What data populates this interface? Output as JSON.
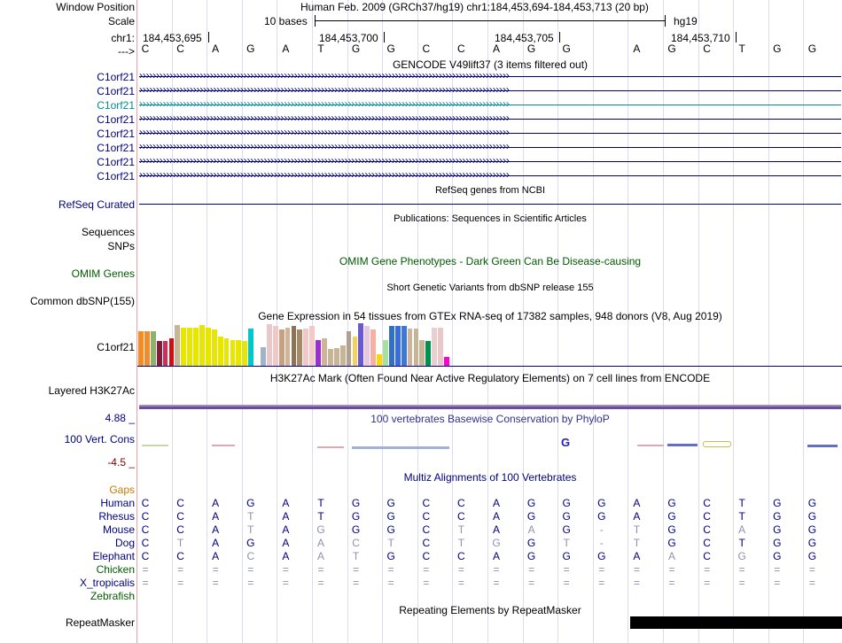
{
  "window_position": {
    "label": "Window Position",
    "text": "Human Feb. 2009 (GRCh37/hg19)   chr1:184,453,694-184,453,713 (20 bp)"
  },
  "scale": {
    "label": "Scale",
    "bases_label": "10 bases",
    "assembly": "hg19"
  },
  "chrom": {
    "label": "chr1:",
    "ticks": [
      "184,453,695",
      "184,453,700",
      "184,453,705",
      "184,453,710"
    ]
  },
  "sequence": {
    "label": "--->",
    "bases": [
      "C",
      "C",
      "A",
      "G",
      "A",
      "T",
      "G",
      "G",
      "C",
      "C",
      "A",
      "G",
      "G",
      "A",
      "G",
      "C",
      "T",
      "G",
      "G"
    ]
  },
  "gencode": {
    "title": "GENCODE V49lift37 (3 items filtered out)",
    "genes": [
      "C1orf21",
      "C1orf21",
      "C1orf21",
      "C1orf21",
      "C1orf21",
      "C1orf21",
      "C1orf21",
      "C1orf21"
    ]
  },
  "refseq": {
    "title": "RefSeq genes from NCBI",
    "label": "RefSeq Curated"
  },
  "publications": {
    "title": "Publications: Sequences in Scientific Articles",
    "label": "Sequences"
  },
  "snps": {
    "label": "SNPs"
  },
  "omim": {
    "title": "OMIM Gene Phenotypes - Dark Green Can Be Disease-causing",
    "label": "OMIM Genes"
  },
  "dbsnp": {
    "title": "Short Genetic Variants from dbSNP release 155",
    "label": "Common dbSNP(155)"
  },
  "gtex": {
    "title": "Gene Expression in 54 tissues from GTEx RNA-seq of 17382 samples, 948 donors (V8, Aug 2019)",
    "label": "C1orf21",
    "bars": [
      {
        "v": 0.82,
        "c": "#f28c28"
      },
      {
        "v": 0.82,
        "c": "#f28c28"
      },
      {
        "v": 0.84,
        "c": "#90b070"
      },
      {
        "v": 0.6,
        "c": "#8b1a3a"
      },
      {
        "v": 0.6,
        "c": "#c8325a"
      },
      {
        "v": 0.65,
        "c": "#d01010"
      },
      {
        "v": 0.98,
        "c": "#c8b496"
      },
      {
        "v": 0.92,
        "c": "#e6e600"
      },
      {
        "v": 0.92,
        "c": "#e6e600"
      },
      {
        "v": 0.92,
        "c": "#e6e600"
      },
      {
        "v": 0.98,
        "c": "#e6e600"
      },
      {
        "v": 0.92,
        "c": "#e6e600"
      },
      {
        "v": 0.88,
        "c": "#e6e600"
      },
      {
        "v": 0.7,
        "c": "#e6e600"
      },
      {
        "v": 0.66,
        "c": "#e6e600"
      },
      {
        "v": 0.62,
        "c": "#e6e600"
      },
      {
        "v": 0.62,
        "c": "#e6e600"
      },
      {
        "v": 0.6,
        "c": "#e6e600"
      },
      {
        "v": 0.9,
        "c": "#00c8c8"
      },
      {
        "v": 0.05,
        "c": "#ffffff"
      },
      {
        "v": 0.45,
        "c": "#a0b4c8"
      },
      {
        "v": 1.0,
        "c": "#e8c8c8"
      },
      {
        "v": 0.95,
        "c": "#f0c8c8"
      },
      {
        "v": 0.88,
        "c": "#c8a080"
      },
      {
        "v": 0.92,
        "c": "#d0b49a"
      },
      {
        "v": 0.95,
        "c": "#8b7355"
      },
      {
        "v": 0.88,
        "c": "#aa8866"
      },
      {
        "v": 0.9,
        "c": "#f0c8c8"
      },
      {
        "v": 0.95,
        "c": "#f4c8c8"
      },
      {
        "v": 0.62,
        "c": "#9932cc"
      },
      {
        "v": 0.65,
        "c": "#d0b49a"
      },
      {
        "v": 0.4,
        "c": "#c8b496"
      },
      {
        "v": 0.42,
        "c": "#c8b496"
      },
      {
        "v": 0.5,
        "c": "#c8b496"
      },
      {
        "v": 0.82,
        "c": "#b0a090"
      },
      {
        "v": 0.7,
        "c": "#f4d060"
      },
      {
        "v": 1.02,
        "c": "#6a5acd"
      },
      {
        "v": 0.96,
        "c": "#e8c8e0"
      },
      {
        "v": 0.88,
        "c": "#f4b0a0"
      },
      {
        "v": 0.28,
        "c": "#ffd700"
      },
      {
        "v": 0.62,
        "c": "#a8e0a0"
      },
      {
        "v": 0.96,
        "c": "#3070c8"
      },
      {
        "v": 0.96,
        "c": "#3c6cd8"
      },
      {
        "v": 0.96,
        "c": "#3c78d8"
      },
      {
        "v": 0.9,
        "c": "#d0b49a"
      },
      {
        "v": 0.9,
        "c": "#c8b496"
      },
      {
        "v": 0.62,
        "c": "#c8b496"
      },
      {
        "v": 0.6,
        "c": "#009050"
      },
      {
        "v": 0.92,
        "c": "#e8d0d0"
      },
      {
        "v": 0.92,
        "c": "#e8c8c8"
      },
      {
        "v": 0.22,
        "c": "#ff00d0"
      }
    ]
  },
  "h3k27ac": {
    "title": "H3K27Ac Mark (Often Found Near Active Regulatory Elements) on 7 cell lines from ENCODE",
    "label": "Layered H3K27Ac"
  },
  "phylop": {
    "title": "100 vertebrates Basewise Conservation by PhyloP",
    "label": "100 Vert. Cons",
    "ymax": "4.88 _",
    "ymin": "-4.5 _"
  },
  "multiz": {
    "title": "Multiz Alignments of 100 Vertebrates",
    "gaps_label": "Gaps",
    "species": [
      {
        "name": "Human",
        "bases": [
          "C",
          "C",
          "A",
          "G",
          "A",
          "T",
          "G",
          "G",
          "C",
          "C",
          "A",
          "G",
          "G",
          "G",
          "A",
          "G",
          "C",
          "T",
          "G",
          "G"
        ]
      },
      {
        "name": "Rhesus",
        "bases": [
          "C",
          "C",
          "A",
          "T",
          "A",
          "T",
          "G",
          "G",
          "C",
          "C",
          "A",
          "G",
          "G",
          "G",
          "A",
          "G",
          "C",
          "T",
          "G",
          "G"
        ]
      },
      {
        "name": "Mouse",
        "bases": [
          "C",
          "C",
          "A",
          "T",
          "A",
          "G",
          "G",
          "G",
          "C",
          "T",
          "A",
          "A",
          "G",
          "-",
          "T",
          "G",
          "C",
          "A",
          "G",
          "G"
        ]
      },
      {
        "name": "Dog",
        "bases": [
          "C",
          "T",
          "A",
          "G",
          "A",
          "A",
          "C",
          "T",
          "C",
          "T",
          "G",
          "G",
          "T",
          "-",
          "T",
          "G",
          "C",
          "T",
          "G",
          "G"
        ]
      },
      {
        "name": "Elephant",
        "bases": [
          "C",
          "C",
          "A",
          "C",
          "A",
          "A",
          "T",
          "G",
          "C",
          "C",
          "A",
          "G",
          "G",
          "G",
          "A",
          "A",
          "C",
          "G",
          "G",
          "G"
        ]
      },
      {
        "name": "Chicken",
        "bases": [
          "=",
          "=",
          "=",
          "=",
          "=",
          "=",
          "=",
          "=",
          "=",
          "=",
          "=",
          "=",
          "=",
          "=",
          "=",
          "=",
          "=",
          "=",
          "=",
          "="
        ]
      },
      {
        "name": "X_tropicalis",
        "bases": [
          "=",
          "=",
          "=",
          "=",
          "=",
          "=",
          "=",
          "=",
          "=",
          "=",
          "=",
          "=",
          "=",
          "=",
          "=",
          "=",
          "=",
          "=",
          "=",
          "="
        ]
      },
      {
        "name": "Zebrafish",
        "bases": []
      }
    ]
  },
  "repeatmasker": {
    "title": "Repeating Elements by RepeatMasker",
    "label": "RepeatMasker"
  },
  "colors": {
    "track_blue": "#000080",
    "highlight_gene": "#008b9b",
    "omim_green": "#005a00",
    "gaps_orange": "#c87800",
    "separator": "#e8a0a0"
  }
}
